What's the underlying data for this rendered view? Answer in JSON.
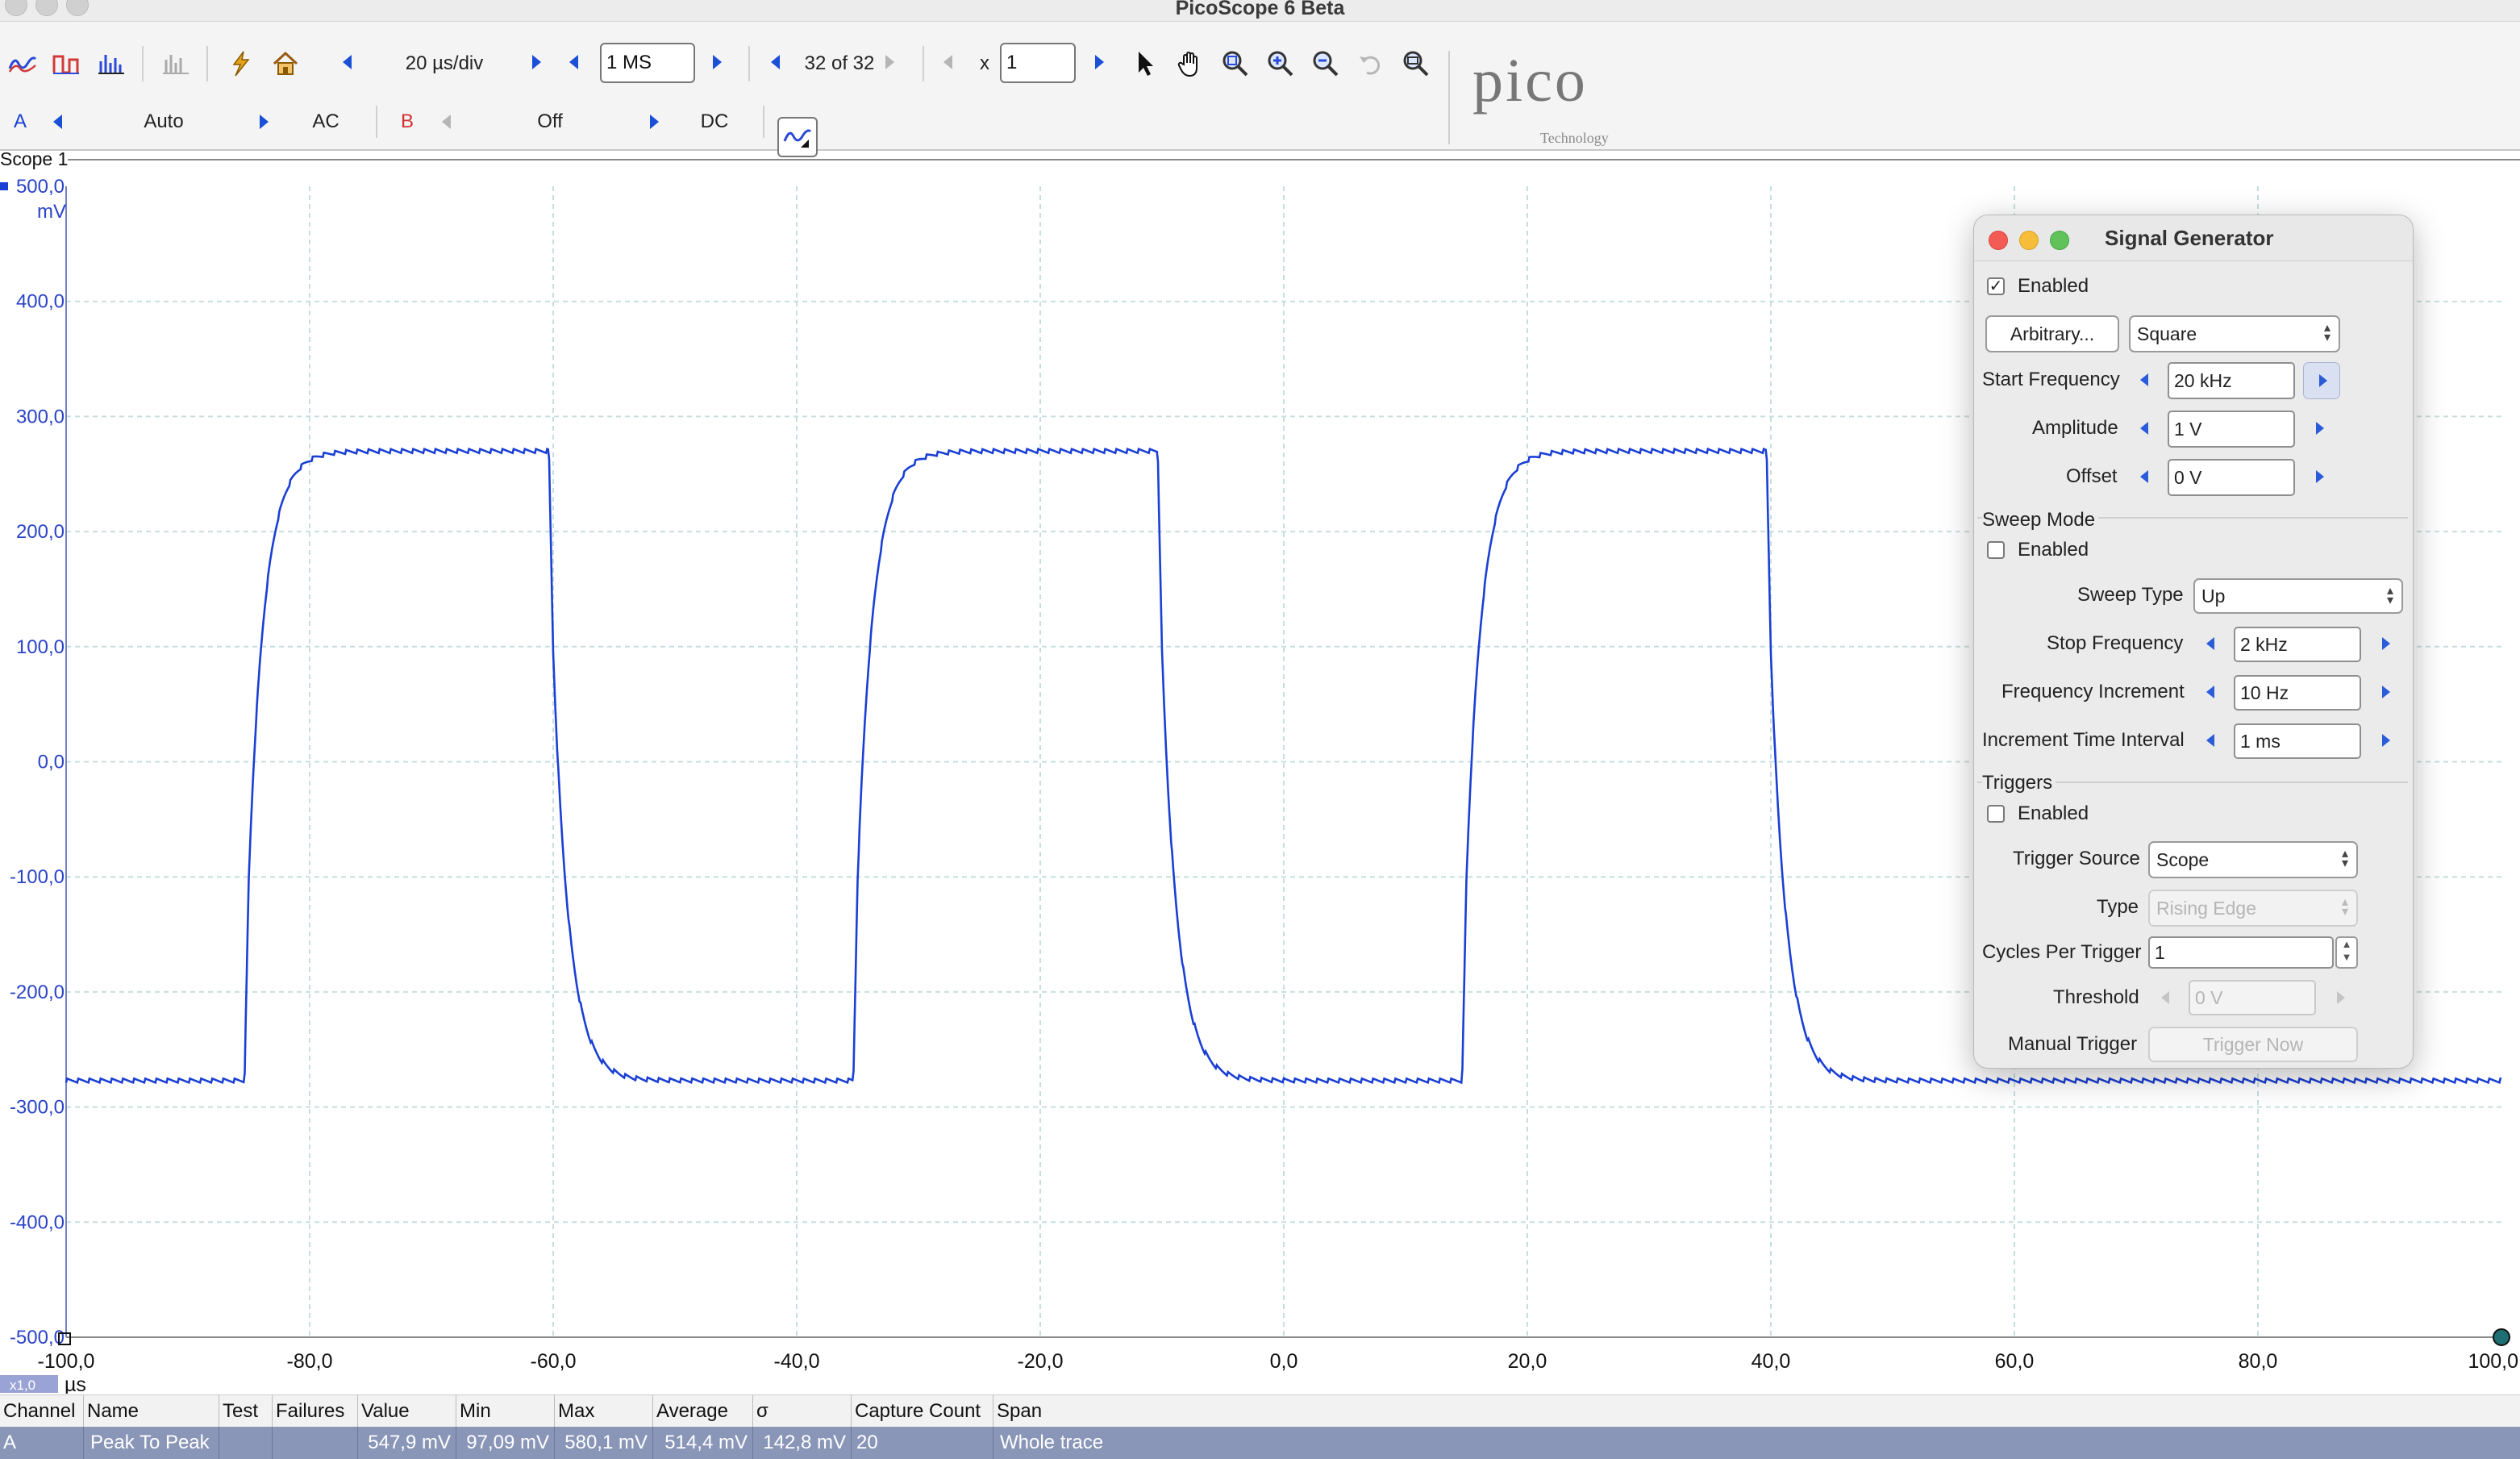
{
  "window": {
    "title": "PicoScope 6 Beta"
  },
  "toolbar": {
    "timebase": "20 µs/div",
    "samples": "1 MS",
    "capture": "32 of 32",
    "zoom_prefix": "x",
    "zoom_value": "1",
    "logo_text": "pico",
    "logo_sub": "Technology"
  },
  "channels": {
    "a": {
      "label": "A",
      "range": "Auto",
      "coupling": "AC",
      "color": "#1a3fd4"
    },
    "b": {
      "label": "B",
      "range": "Off",
      "coupling": "DC",
      "color": "#d43030"
    }
  },
  "scope": {
    "tab_label": "Scope 1"
  },
  "chart_data": {
    "type": "line",
    "title": "",
    "xlabel": "µs",
    "ylabel": "mV",
    "xlim": [
      -100,
      100
    ],
    "ylim": [
      -500,
      500
    ],
    "x_ticks": [
      "-100,0",
      "-80,0",
      "-60,0",
      "-40,0",
      "-20,0",
      "0,0",
      "20,0",
      "40,0",
      "60,0",
      "80,0",
      "100,0"
    ],
    "y_ticks": [
      "500,0",
      "400,0",
      "300,0",
      "200,0",
      "100,0",
      "0,0",
      "-100,0",
      "-200,0",
      "-300,0",
      "-400,0",
      "-500,0"
    ],
    "x_unit": "µs",
    "y_unit": "mV",
    "zoom_badge": "x1,0",
    "grid": true,
    "series": [
      {
        "name": "A",
        "color": "#1a3fd4",
        "waveform": "square",
        "high_mV": 270,
        "low_mV": -277,
        "rising_edges_us": [
          -85,
          -35,
          15
        ],
        "falling_edges_us": [
          -60,
          -10,
          40
        ]
      }
    ]
  },
  "measurements": {
    "headers": [
      "Channel",
      "Name",
      "Test",
      "Failures",
      "Value",
      "Min",
      "Max",
      "Average",
      "σ",
      "Capture Count",
      "Span"
    ],
    "rows": [
      [
        "A",
        "Peak To Peak",
        "",
        "",
        "547,9 mV",
        "97,09 mV",
        "580,1 mV",
        "514,4 mV",
        "142,8 mV",
        "20",
        "Whole trace"
      ]
    ]
  },
  "signal_generator": {
    "title": "Signal Generator",
    "enabled_label": "Enabled",
    "enabled": true,
    "arbitrary_button": "Arbitrary...",
    "waveform": "Square",
    "start_frequency_label": "Start Frequency",
    "start_frequency": "20 kHz",
    "amplitude_label": "Amplitude",
    "amplitude": "1 V",
    "offset_label": "Offset",
    "offset": "0 V",
    "sweep": {
      "group_label": "Sweep Mode",
      "enabled_label": "Enabled",
      "enabled": false,
      "type_label": "Sweep Type",
      "type": "Up",
      "stop_frequency_label": "Stop Frequency",
      "stop_frequency": "2 kHz",
      "increment_label": "Frequency Increment",
      "increment": "10 Hz",
      "interval_label": "Increment Time Interval",
      "interval": "1 ms"
    },
    "triggers": {
      "group_label": "Triggers",
      "enabled_label": "Enabled",
      "enabled": false,
      "source_label": "Trigger Source",
      "source": "Scope",
      "type_label": "Type",
      "type": "Rising Edge",
      "cycles_label": "Cycles Per Trigger",
      "cycles": "1",
      "threshold_label": "Threshold",
      "threshold": "0 V",
      "manual_label": "Manual Trigger",
      "manual_button": "Trigger Now"
    }
  }
}
